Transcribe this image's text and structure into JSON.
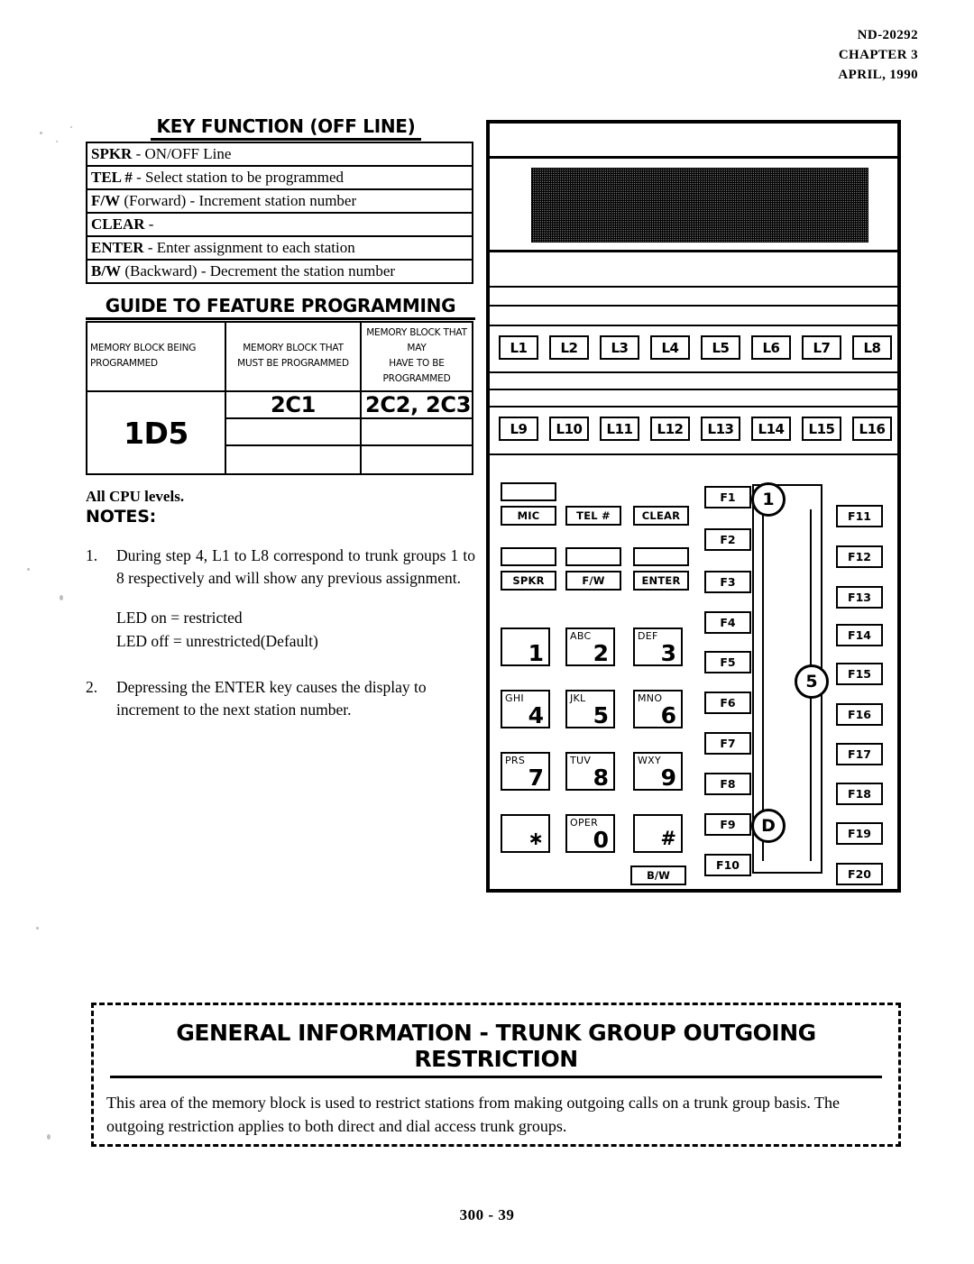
{
  "header": {
    "doc_id": "ND-20292",
    "chapter": "CHAPTER 3",
    "date": "APRIL, 1990"
  },
  "key_function": {
    "title": "KEY FUNCTION (OFF LINE)",
    "rows": [
      {
        "key": "SPKR",
        "sep": " - ",
        "desc": "ON/OFF Line"
      },
      {
        "key": "TEL #",
        "sep": " - ",
        "desc": "Select station to be programmed"
      },
      {
        "key": "F/W",
        "paren": " (Forward)",
        "sep": " - ",
        "desc": "Increment station number"
      },
      {
        "key": "CLEAR",
        "sep": " -",
        "desc": ""
      },
      {
        "key": "ENTER",
        "sep": " - ",
        "desc": "Enter assignment to each station"
      },
      {
        "key": "B/W",
        "paren": " (Backward)",
        "sep": " - ",
        "desc": "Decrement the station number"
      }
    ]
  },
  "guide": {
    "title": "GUIDE TO FEATURE PROGRAMMING",
    "headers": [
      "MEMORY BLOCK BEING PROGRAMMED",
      "MEMORY BLOCK THAT MUST BE PROGRAMMED",
      "MEMORY BLOCK THAT MAY HAVE TO BE PROGRAMMED"
    ],
    "header_lines": [
      [
        "MEMORY BLOCK BEING",
        "PROGRAMMED"
      ],
      [
        "MEMORY BLOCK THAT",
        "MUST BE PROGRAMMED"
      ],
      [
        "MEMORY BLOCK THAT MAY",
        "HAVE TO BE PROGRAMMED"
      ]
    ],
    "block_being_programmed": "1D5",
    "must_be_programmed": [
      "2C1",
      "",
      ""
    ],
    "may_have_to_be_programmed": [
      "2C2, 2C3",
      "",
      ""
    ]
  },
  "notes": {
    "cpu_levels": "All CPU levels.",
    "label": "NOTES:",
    "items": [
      {
        "num": "1.",
        "text": "During step 4, L1 to L8  correspond to trunk groups 1 to 8 respectively and will show any previous assignment.",
        "extra_lines": [
          "LED on = restricted",
          "LED off = unrestricted(Default)"
        ]
      },
      {
        "num": "2.",
        "text": "Depressing the ENTER key causes the display to increment to the next station number.",
        "extra_lines": []
      }
    ]
  },
  "phone": {
    "display_label": "lcd-display",
    "line_keys_row1": [
      "L1",
      "L2",
      "L3",
      "L4",
      "L5",
      "L6",
      "L7",
      "L8"
    ],
    "line_keys_row2": [
      "L9",
      "L10",
      "L11",
      "L12",
      "L13",
      "L14",
      "L15",
      "L16"
    ],
    "function_keys": [
      "MIC",
      "TEL #",
      "CLEAR",
      "SPKR",
      "F/W",
      "ENTER"
    ],
    "dial_keys": [
      {
        "alpha": "",
        "digit": "1"
      },
      {
        "alpha": "ABC",
        "digit": "2"
      },
      {
        "alpha": "DEF",
        "digit": "3"
      },
      {
        "alpha": "GHI",
        "digit": "4"
      },
      {
        "alpha": "JKL",
        "digit": "5"
      },
      {
        "alpha": "MNO",
        "digit": "6"
      },
      {
        "alpha": "PRS",
        "digit": "7"
      },
      {
        "alpha": "TUV",
        "digit": "8"
      },
      {
        "alpha": "WXY",
        "digit": "9"
      },
      {
        "alpha": "",
        "digit": "∗"
      },
      {
        "alpha": "OPER",
        "digit": "0"
      },
      {
        "alpha": "",
        "digit": "#"
      }
    ],
    "backward_key": "B/W",
    "f_keys_left": [
      "F1",
      "F2",
      "F3",
      "F4",
      "F5",
      "F6",
      "F7",
      "F8",
      "F9",
      "F10"
    ],
    "f_keys_right": [
      "F11",
      "F12",
      "F13",
      "F14",
      "F15",
      "F16",
      "F17",
      "F18",
      "F19",
      "F20"
    ],
    "callouts": [
      "1",
      "5",
      "D"
    ]
  },
  "general_info": {
    "title": "GENERAL INFORMATION  -  TRUNK GROUP OUTGOING RESTRICTION",
    "body": "This area of the memory block is used to restrict stations from making outgoing calls on a trunk group basis. The outgoing restriction applies to both direct and dial access trunk groups."
  },
  "footer": {
    "page_number": "300 - 39"
  }
}
